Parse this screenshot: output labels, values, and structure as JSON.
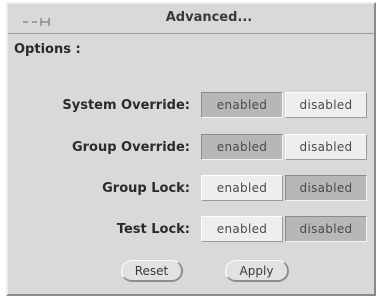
{
  "window": {
    "title": "Advanced..."
  },
  "section": {
    "label": "Options :"
  },
  "rows": [
    {
      "label": "System Override:",
      "options": [
        "enabled",
        "disabled"
      ],
      "selected": "enabled"
    },
    {
      "label": "Group Override:",
      "options": [
        "enabled",
        "disabled"
      ],
      "selected": "enabled"
    },
    {
      "label": "Group Lock:",
      "options": [
        "enabled",
        "disabled"
      ],
      "selected": "disabled"
    },
    {
      "label": "Test Lock:",
      "options": [
        "enabled",
        "disabled"
      ],
      "selected": "disabled"
    }
  ],
  "buttons": {
    "reset_label": "Reset",
    "apply_label": "Apply"
  },
  "icons": {
    "window_menu": "window-menu-icon"
  },
  "colors": {
    "panel": "#d9d9d9",
    "selected_segment": "#b7b7b7",
    "unselected_segment": "#eeeeee"
  }
}
